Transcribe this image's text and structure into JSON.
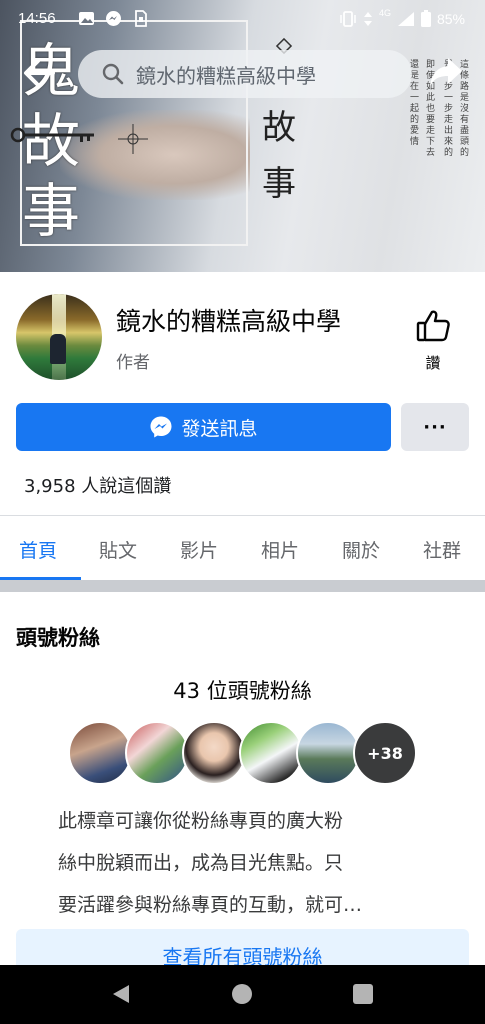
{
  "status_bar": {
    "time": "14:56",
    "network": "4G",
    "battery": "85%"
  },
  "header": {
    "search_text": "鏡水的糟糕高級中學"
  },
  "cover": {
    "calligraphy_left": "鬼故事",
    "calligraphy_right": "故事",
    "poem_lines": [
      "這條路是沒有盡頭的",
      "是一步一步走出來的",
      "即使如此也要走下去",
      "還是在一起的愛情"
    ]
  },
  "profile": {
    "name": "鏡水的糟糕高級中學",
    "role": "作者",
    "like_label": "讚",
    "message_label": "發送訊息",
    "more_label": "···",
    "likes_count": "3,958 人說這個讚"
  },
  "tabs": [
    "首頁",
    "貼文",
    "影片",
    "相片",
    "關於",
    "社群"
  ],
  "active_tab": "首頁",
  "fans": {
    "title": "頭號粉絲",
    "count": "43 位頭號粉絲",
    "more_count": "+38",
    "description": [
      "此標章可讓你從粉絲專頁的廣大粉",
      "絲中脫穎而出，成為目光焦點。只",
      "要活躍參與粉絲專頁的互動，就可…"
    ],
    "view_all": "查看所有頭號粉絲"
  },
  "colors": {
    "accent": "#1877f2",
    "secondary_button": "#e4e6eb",
    "light_accent": "#e7f3ff"
  }
}
